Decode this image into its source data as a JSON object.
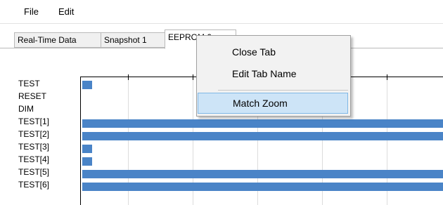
{
  "menubar": {
    "file": "File",
    "edit": "Edit"
  },
  "tabs": [
    {
      "label": "Real-Time Data",
      "active": false
    },
    {
      "label": "Snapshot 1",
      "active": false
    },
    {
      "label": "EEPROM 0",
      "active": true
    }
  ],
  "signals": [
    "TEST",
    "RESET",
    "DIM",
    "TEST[1]",
    "TEST[2]",
    "TEST[3]",
    "TEST[4]",
    "TEST[5]",
    "TEST[6]"
  ],
  "context_menu": {
    "items": [
      {
        "label": "Close Tab",
        "highlighted": false
      },
      {
        "label": "Edit Tab Name",
        "highlighted": false
      },
      {
        "label": "Match Zoom",
        "highlighted": true
      }
    ]
  },
  "colors": {
    "bar": "#4a84c7",
    "menu_highlight": "#cde4f7"
  }
}
